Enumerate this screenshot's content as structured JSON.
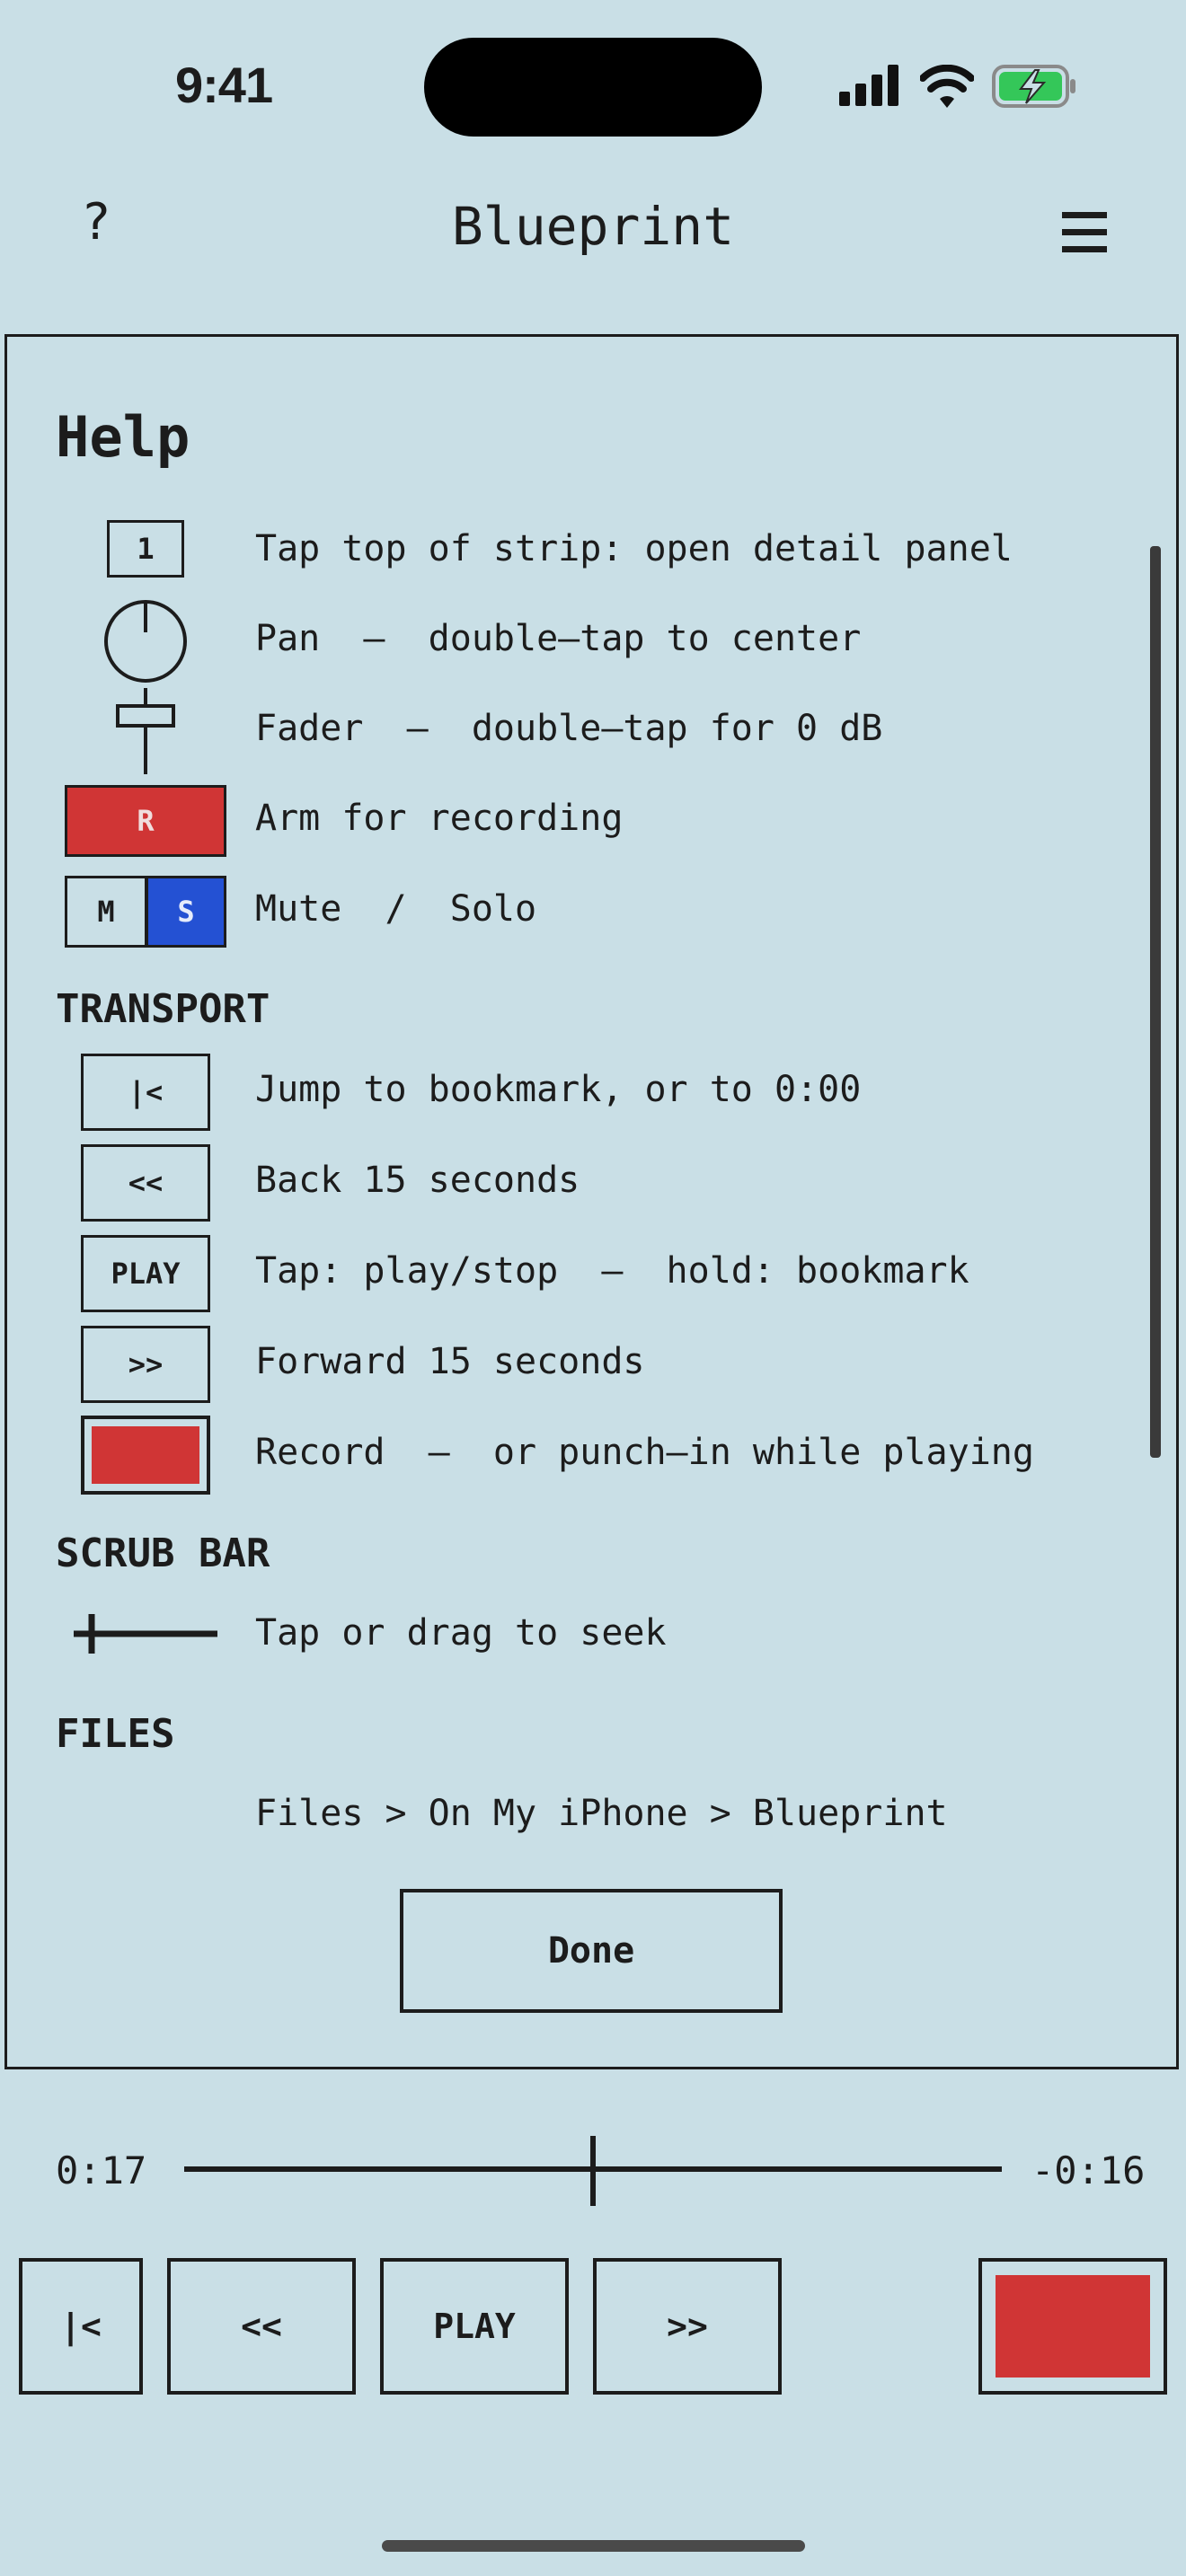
{
  "status": {
    "time": "9:41"
  },
  "nav": {
    "help": "?",
    "title": "Blueprint",
    "menu_icon": "hamburger-menu-icon"
  },
  "help": {
    "title": "Help",
    "strip": {
      "channel_number": "1",
      "strip_desc": "Tap top of strip: open detail panel",
      "pan_desc": "Pan  –  double–tap to center",
      "fader_desc": "Fader  –  double–tap for 0 dB",
      "arm_label": "R",
      "arm_desc": "Arm for recording",
      "mute_label": "M",
      "solo_label": "S",
      "mute_solo_desc": "Mute  /  Solo"
    },
    "transport": {
      "heading": "TRANSPORT",
      "items": [
        {
          "label": "|<",
          "desc": "Jump to bookmark, or to 0:00"
        },
        {
          "label": "<<",
          "desc": "Back 15 seconds"
        },
        {
          "label": "PLAY",
          "desc": "Tap: play/stop  –  hold: bookmark"
        },
        {
          "label": ">>",
          "desc": "Forward 15 seconds"
        },
        {
          "label": "",
          "desc": "Record  –  or punch–in while playing"
        }
      ]
    },
    "scrub": {
      "heading": "SCRUB BAR",
      "desc": "Tap or drag to seek"
    },
    "files": {
      "heading": "FILES",
      "desc": "Files > On My iPhone > Blueprint"
    },
    "done": "Done"
  },
  "scrubber": {
    "elapsed": "0:17",
    "remaining": "-0:16",
    "position": 0.5
  },
  "transport": {
    "jump": "|<",
    "back": "<<",
    "play": "PLAY",
    "forward": ">>"
  },
  "colors": {
    "background": "#c9dfe6",
    "record": "#d03535",
    "solo": "#2451d3",
    "battery": "#34c759"
  }
}
